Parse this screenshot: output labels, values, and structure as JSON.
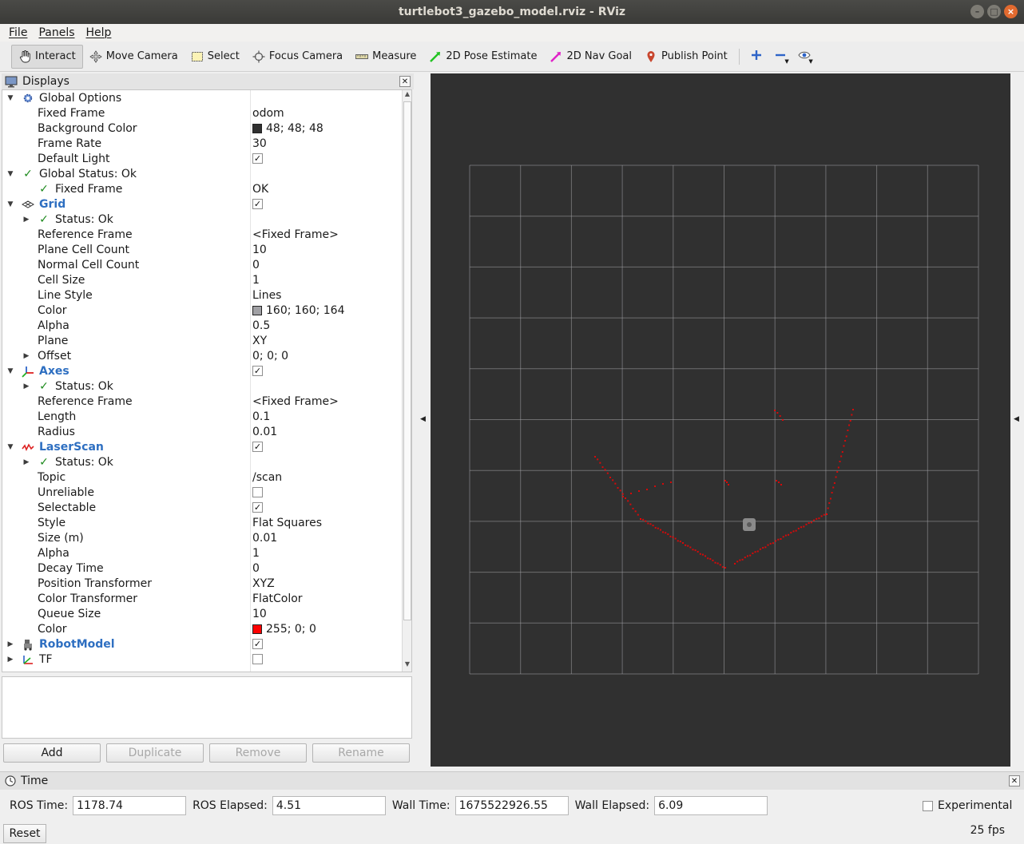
{
  "window": {
    "title": "turtlebot3_gazebo_model.rviz - RViz"
  },
  "menubar": {
    "items": [
      "File",
      "Panels",
      "Help"
    ]
  },
  "toolbar": {
    "tools": [
      {
        "label": "Interact",
        "icon": "interact-hand-icon",
        "active": true
      },
      {
        "label": "Move Camera",
        "icon": "move-camera-icon"
      },
      {
        "label": "Select",
        "icon": "select-rect-icon"
      },
      {
        "label": "Focus Camera",
        "icon": "focus-camera-icon"
      },
      {
        "label": "Measure",
        "icon": "ruler-icon"
      },
      {
        "label": "2D Pose Estimate",
        "icon": "green-arrow-icon",
        "color": "#22c322"
      },
      {
        "label": "2D Nav Goal",
        "icon": "magenta-arrow-icon",
        "color": "#e022c8"
      },
      {
        "label": "Publish Point",
        "icon": "map-pin-icon",
        "color": "#c8462e"
      }
    ],
    "extra_icons": [
      "plus-icon",
      "minus-icon",
      "eye-icon"
    ]
  },
  "displays": {
    "title": "Displays",
    "rows": [
      {
        "indent": 0,
        "arrow": "down",
        "icon": "gear",
        "label": "Global Options",
        "value": ""
      },
      {
        "indent": 1,
        "label": "Fixed Frame",
        "value": "odom"
      },
      {
        "indent": 1,
        "label": "Background Color",
        "value": "48; 48; 48",
        "swatch": "#303030"
      },
      {
        "indent": 1,
        "label": "Frame Rate",
        "value": "30"
      },
      {
        "indent": 1,
        "label": "Default Light",
        "checkbox": true
      },
      {
        "indent": 0,
        "arrow": "down",
        "icon": "check",
        "label": "Global Status: Ok",
        "value": ""
      },
      {
        "indent": 1,
        "icon": "check",
        "label": "Fixed Frame",
        "value": "OK"
      },
      {
        "indent": 0,
        "arrow": "down",
        "icon": "grid",
        "label": "Grid",
        "blue": true,
        "checkbox": true
      },
      {
        "indent": 1,
        "arrow": "right",
        "icon": "check",
        "label": "Status: Ok",
        "value": ""
      },
      {
        "indent": 1,
        "label": "Reference Frame",
        "value": "<Fixed Frame>"
      },
      {
        "indent": 1,
        "label": "Plane Cell Count",
        "value": "10"
      },
      {
        "indent": 1,
        "label": "Normal Cell Count",
        "value": "0"
      },
      {
        "indent": 1,
        "label": "Cell Size",
        "value": "1"
      },
      {
        "indent": 1,
        "label": "Line Style",
        "value": "Lines"
      },
      {
        "indent": 1,
        "label": "Color",
        "value": "160; 160; 164",
        "swatch": "#a0a0a4"
      },
      {
        "indent": 1,
        "label": "Alpha",
        "value": "0.5"
      },
      {
        "indent": 1,
        "label": "Plane",
        "value": "XY"
      },
      {
        "indent": 1,
        "arrow": "right",
        "label": "Offset",
        "value": "0; 0; 0"
      },
      {
        "indent": 0,
        "arrow": "down",
        "icon": "axes",
        "label": "Axes",
        "blue": true,
        "checkbox": true
      },
      {
        "indent": 1,
        "arrow": "right",
        "icon": "check",
        "label": "Status: Ok",
        "value": ""
      },
      {
        "indent": 1,
        "label": "Reference Frame",
        "value": "<Fixed Frame>"
      },
      {
        "indent": 1,
        "label": "Length",
        "value": "0.1"
      },
      {
        "indent": 1,
        "label": "Radius",
        "value": "0.01"
      },
      {
        "indent": 0,
        "arrow": "down",
        "icon": "laser",
        "label": "LaserScan",
        "blue": true,
        "checkbox": true
      },
      {
        "indent": 1,
        "arrow": "right",
        "icon": "check",
        "label": "Status: Ok",
        "value": ""
      },
      {
        "indent": 1,
        "label": "Topic",
        "value": "/scan"
      },
      {
        "indent": 1,
        "label": "Unreliable",
        "checkbox": false
      },
      {
        "indent": 1,
        "label": "Selectable",
        "checkbox": true
      },
      {
        "indent": 1,
        "label": "Style",
        "value": "Flat Squares"
      },
      {
        "indent": 1,
        "label": "Size (m)",
        "value": "0.01"
      },
      {
        "indent": 1,
        "label": "Alpha",
        "value": "1"
      },
      {
        "indent": 1,
        "label": "Decay Time",
        "value": "0"
      },
      {
        "indent": 1,
        "label": "Position Transformer",
        "value": "XYZ"
      },
      {
        "indent": 1,
        "label": "Color Transformer",
        "value": "FlatColor"
      },
      {
        "indent": 1,
        "label": "Queue Size",
        "value": "10"
      },
      {
        "indent": 1,
        "label": "Color",
        "value": "255; 0; 0",
        "swatch": "#ff0000"
      },
      {
        "indent": 0,
        "arrow": "right",
        "icon": "robot",
        "label": "RobotModel",
        "blue": true,
        "checkbox": true
      },
      {
        "indent": 0,
        "arrow": "right",
        "icon": "tf",
        "label": "TF",
        "checkbox": false
      }
    ],
    "buttons": [
      {
        "label": "Add",
        "enabled": true
      },
      {
        "label": "Duplicate",
        "enabled": false
      },
      {
        "label": "Remove",
        "enabled": false
      },
      {
        "label": "Rename",
        "enabled": false
      }
    ]
  },
  "viewport": {
    "background": "#303030",
    "grid_color": "#a0a0a4",
    "laser_color": "#ff0000",
    "grid_cells": 10
  },
  "time": {
    "title": "Time",
    "ros_time_label": "ROS Time:",
    "ros_time": "1178.74",
    "ros_elapsed_label": "ROS Elapsed:",
    "ros_elapsed": "4.51",
    "wall_time_label": "Wall Time:",
    "wall_time": "1675522926.55",
    "wall_elapsed_label": "Wall Elapsed:",
    "wall_elapsed": "6.09",
    "experimental_label": "Experimental",
    "reset_label": "Reset",
    "fps": "25 fps"
  }
}
